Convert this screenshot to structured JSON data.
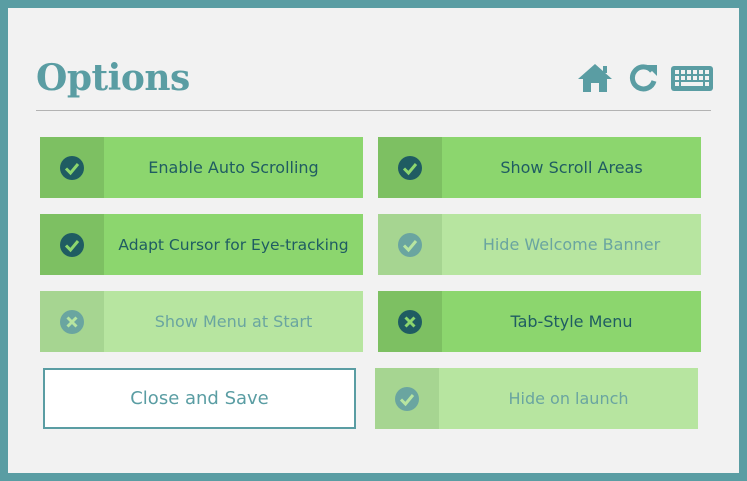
{
  "dialog": {
    "title": "Options"
  },
  "header_icons": [
    "home-icon",
    "refresh-icon",
    "keyboard-icon"
  ],
  "options": [
    {
      "label": "Enable Auto Scrolling",
      "state": "checked",
      "enabled": true
    },
    {
      "label": "Show Scroll Areas",
      "state": "checked",
      "enabled": true
    },
    {
      "label": "Adapt Cursor for Eye-tracking",
      "state": "checked",
      "enabled": true
    },
    {
      "label": "Hide Welcome Banner",
      "state": "checked",
      "enabled": false
    },
    {
      "label": "Show Menu at Start",
      "state": "unchecked",
      "enabled": false
    },
    {
      "label": "Tab-Style Menu",
      "state": "unchecked",
      "enabled": true
    },
    {
      "label": "Hide on launch",
      "state": "checked",
      "enabled": false
    }
  ],
  "buttons": {
    "close_save": "Close and Save"
  },
  "colors": {
    "accent": "#5a9da3",
    "active_bg": "#8cd66e",
    "active_check_bg": "#7dc062",
    "inactive_bg": "#b7e5a0",
    "inactive_check_bg": "#a6d591",
    "check_circle": "#1f5c62",
    "dialog_bg": "#f2f2f2"
  }
}
